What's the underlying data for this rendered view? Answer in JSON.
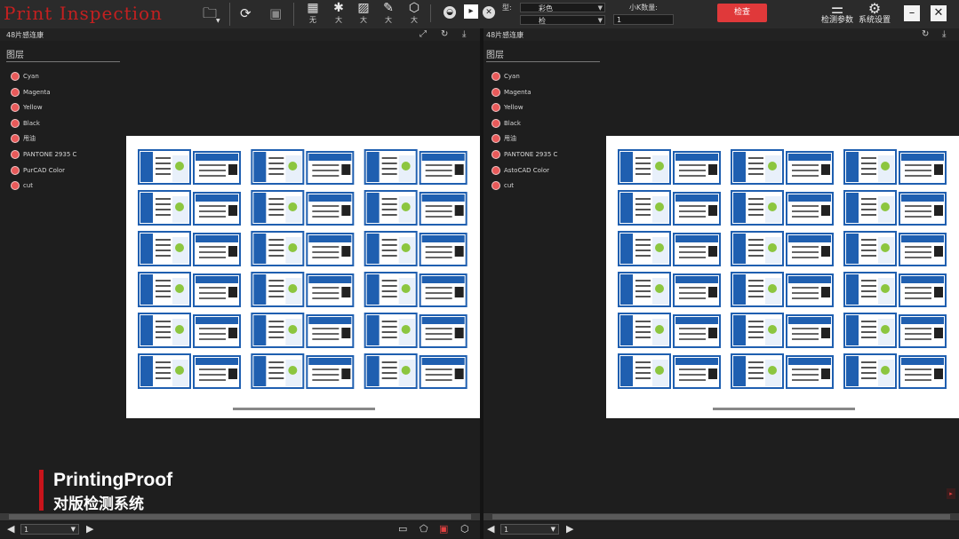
{
  "app_title": "Print Inspection",
  "toolbar": {
    "folder_icon": "folder-open-icon",
    "tools": [
      {
        "icon": "grid-icon",
        "glyph": "▦",
        "label": "无"
      },
      {
        "icon": "aperture-icon",
        "glyph": "✱",
        "label": "大"
      },
      {
        "icon": "hatch-icon",
        "glyph": "▨",
        "label": "大"
      },
      {
        "icon": "pen-icon",
        "glyph": "✎",
        "label": "大"
      },
      {
        "icon": "cube-icon",
        "glyph": "⬡",
        "label": "大"
      }
    ],
    "type_label": "型:",
    "type_value": "彩色",
    "second_value": "检",
    "qty_label": "小K数量:",
    "qty_value": "1",
    "inspect_button": "检查",
    "params_button": "检测参数",
    "settings_button": "系统设置",
    "minimize_glyph": "–",
    "close_glyph": "✕"
  },
  "left_panel": {
    "title": "48片感连康",
    "layers_title": "图层",
    "layers": [
      "Cyan",
      "Magenta",
      "Yellow",
      "Black",
      "甩油",
      "PANTONE 2935 C",
      "PurCAD Color",
      "cut"
    ],
    "page_value": "1"
  },
  "right_panel": {
    "title": "48片感连康",
    "layers_title": "图层",
    "layers": [
      "Cyan",
      "Magenta",
      "Yellow",
      "Black",
      "甩油",
      "PANTONE 2935 C",
      "AstoCAD Color",
      "cut"
    ],
    "page_value": "1"
  },
  "brand": {
    "line1": "PrintingProof",
    "line2": "对版检测系统"
  },
  "colors": {
    "accent_red": "#e0393a",
    "title_red": "#c42020",
    "print_blue": "#1f5fb0",
    "print_green": "#8cc63f"
  }
}
